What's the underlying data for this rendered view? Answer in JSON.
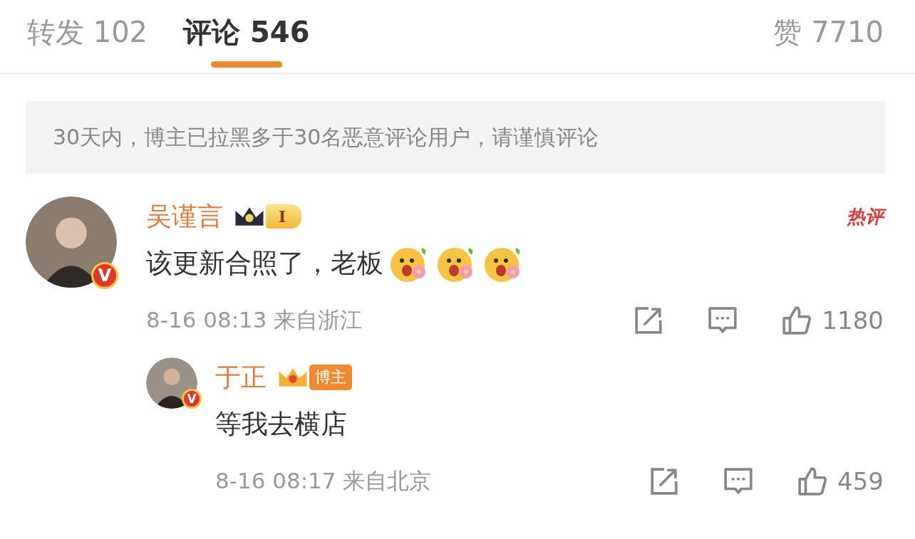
{
  "tabs": [
    {
      "label": "转发",
      "count": "102",
      "selected": false
    },
    {
      "label": "评论",
      "count": "546",
      "selected": true
    },
    {
      "label": "赞",
      "count": "7710",
      "selected": false
    }
  ],
  "notice": "30天内，博主已拉黑多于30名恶意评论用户，请谨慎评论",
  "comments": [
    {
      "name": "吴谨言",
      "badge": {
        "kind": "level",
        "label": "I"
      },
      "verified_badge": "V",
      "hot_label": "热评",
      "text": "该更新合照了，老板",
      "emojis": [
        {
          "kind": "flower-face"
        },
        {
          "kind": "flower-face"
        },
        {
          "kind": "flower-face"
        }
      ],
      "time": "8-16 08:13",
      "location": "来自浙江",
      "likes": "1180",
      "replies": [
        {
          "name": "于正",
          "badge": {
            "kind": "crown",
            "label": "博主"
          },
          "verified_badge": "V",
          "text": "等我去横店",
          "time": "8-16 08:17",
          "location": "来自北京",
          "likes": "459"
        }
      ]
    }
  ]
}
